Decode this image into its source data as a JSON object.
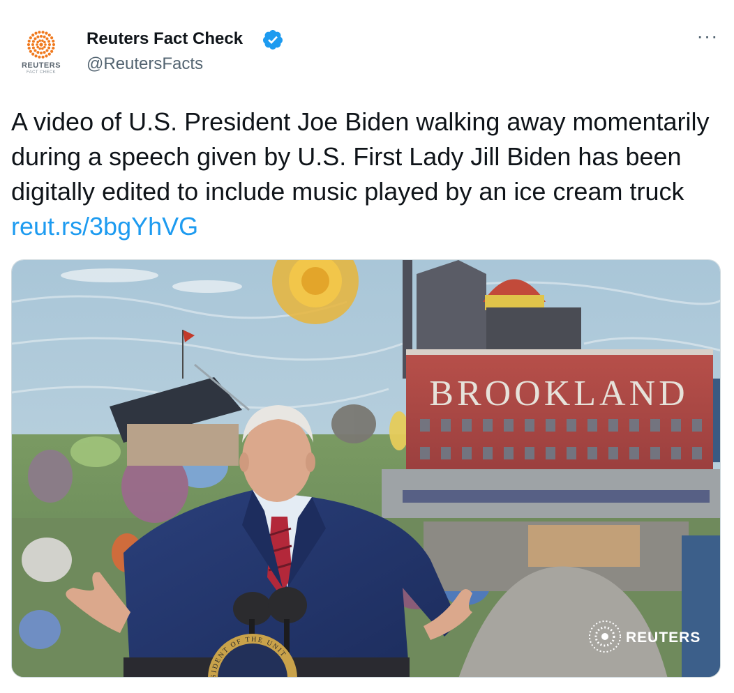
{
  "account": {
    "display_name": "Reuters Fact Check",
    "handle": "@ReutersFacts",
    "avatar_text": "REUTERS",
    "avatar_subtext": "FACT CHECK",
    "verified": true,
    "verified_color": "#1d9bf0"
  },
  "menu": {
    "more_label": "···"
  },
  "tweet": {
    "text": "A video of U.S. President Joe Biden walking away momentarily during a speech given by U.S. First Lady Jill Biden has been digitally edited to include music played by an ice cream truck ",
    "link": "reut.rs/3bgYhVG"
  },
  "media": {
    "mural_sign": "BROOKLAND",
    "watermark": "REUTERS",
    "seal_text": "SIDENT OF THE UNIT"
  },
  "colors": {
    "accent": "#1d9bf0",
    "text_primary": "#0f1419",
    "text_secondary": "#536471",
    "reuters_orange": "#f07a1f"
  }
}
